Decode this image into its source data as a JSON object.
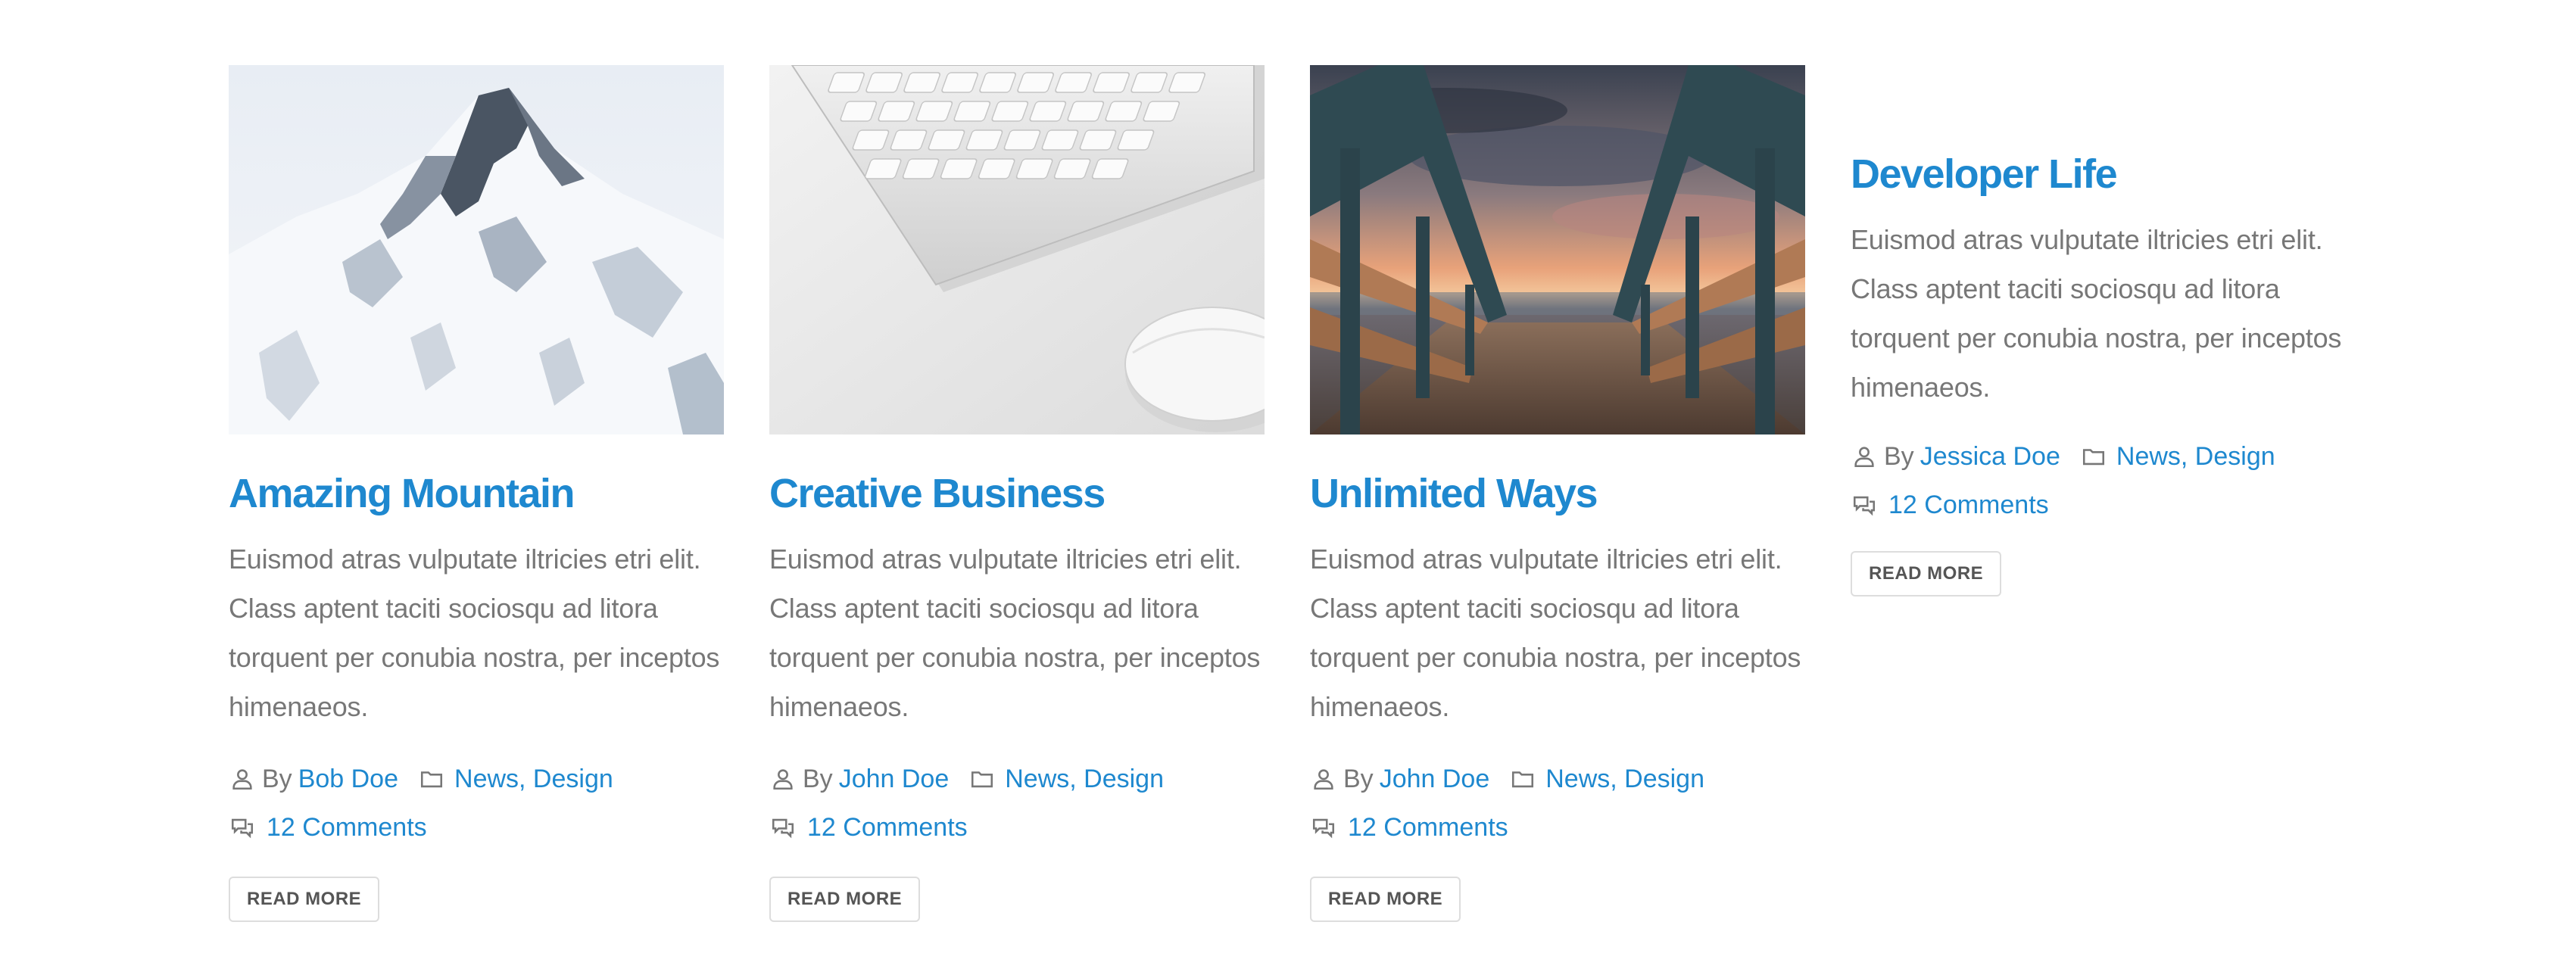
{
  "accent_color": "#1e88cf",
  "text_color": "#777777",
  "posts": [
    {
      "image": "snowy-mountain-photo",
      "title": "Amazing Mountain",
      "excerpt": "Euismod atras vulputate iltricies etri elit. Class aptent taciti sociosqu ad litora torquent per conubia nostra, per inceptos himenaeos.",
      "by_label": "By",
      "author": "Bob Doe",
      "categories": "News, Design",
      "comments": "12 Comments",
      "read_more": "READ MORE"
    },
    {
      "image": "keyboard-mouse-photo",
      "title": "Creative Business",
      "excerpt": "Euismod atras vulputate iltricies etri elit. Class aptent taciti sociosqu ad litora torquent per conubia nostra, per inceptos himenaeos.",
      "by_label": "By",
      "author": "John Doe",
      "categories": "News, Design",
      "comments": "12 Comments",
      "read_more": "READ MORE"
    },
    {
      "image": "beach-boardwalk-sunset-photo",
      "title": "Unlimited Ways",
      "excerpt": "Euismod atras vulputate iltricies etri elit. Class aptent taciti sociosqu ad litora torquent per conubia nostra, per inceptos himenaeos.",
      "by_label": "By",
      "author": "John Doe",
      "categories": "News, Design",
      "comments": "12 Comments",
      "read_more": "READ MORE"
    },
    {
      "image": null,
      "title": "Developer Life",
      "excerpt": "Euismod atras vulputate iltricies etri elit. Class aptent taciti sociosqu ad litora torquent per conubia nostra, per inceptos himenaeos.",
      "by_label": "By",
      "author": "Jessica Doe",
      "categories": "News, Design",
      "comments": "12 Comments",
      "read_more": "READ MORE"
    }
  ]
}
